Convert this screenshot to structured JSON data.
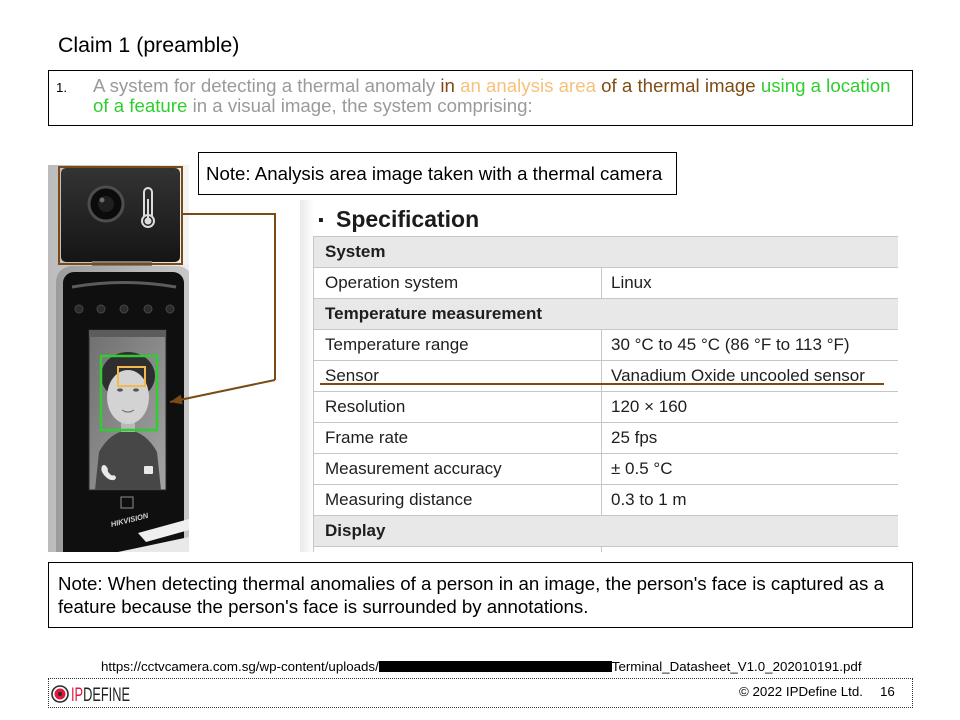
{
  "slide": {
    "title": "Claim 1 (preamble)",
    "claim": {
      "number": "1.",
      "segments": [
        {
          "text": "A system for detecting a thermal anomaly ",
          "color": "#9a9a9a"
        },
        {
          "text": "in ",
          "color": "#7f4c14"
        },
        {
          "text": "an analysis area ",
          "color": "#f6c27a"
        },
        {
          "text": "of a thermal image ",
          "color": "#7f4c14"
        },
        {
          "text": "using a location of a feature",
          "color": "#2fce2f"
        },
        {
          "text": " in a visual image, the system comprising:",
          "color": "#9a9a9a"
        }
      ]
    },
    "note_top": "Note: Analysis area image taken with a thermal camera",
    "note_bottom": "Note: When detecting thermal anomalies of a person in an image, the person's face is captured as a feature because the person's face is surrounded by annotations."
  },
  "annotation_colors": {
    "thermal_camera_box": "#7b4a16",
    "connector": "#7b4a16",
    "feature_box": "#2fce2f",
    "analysis_area_box": "#f5b84e",
    "sensor_underline": "#7b4a16"
  },
  "device_photo": {
    "brand_logo": "HIKVISION"
  },
  "spec": {
    "bullet": "▪",
    "heading": "Specification",
    "rows": [
      {
        "type": "section",
        "label": "System"
      },
      {
        "label": "Operation system",
        "value": "Linux"
      },
      {
        "type": "section",
        "label": "Temperature measurement"
      },
      {
        "label": "Temperature range",
        "value": "30 °C to 45 °C (86 °F to 113 °F)"
      },
      {
        "label": "Sensor",
        "value": "Vanadium Oxide uncooled sensor",
        "underlined": true
      },
      {
        "label": "Resolution",
        "value": "120 × 160"
      },
      {
        "label": "Frame rate",
        "value": "25 fps"
      },
      {
        "label": "Measurement accuracy",
        "value": "± 0.5 °C"
      },
      {
        "label": "Measuring distance",
        "value": "0.3 to 1 m"
      },
      {
        "type": "section",
        "label": "Display"
      }
    ]
  },
  "footer": {
    "source_url_prefix": "https://cctvcamera.com.sg/wp-content/uploads/",
    "source_url_suffix": "Terminal_Datasheet_V1.0_202010191.pdf",
    "logo_prefix": "IP",
    "logo_suffix": "DEFINE",
    "logo_colors": {
      "accent": "#e2163e",
      "dark": "#222222"
    },
    "copyright": "© 2022 IPDefine Ltd.",
    "page_number": "16"
  }
}
